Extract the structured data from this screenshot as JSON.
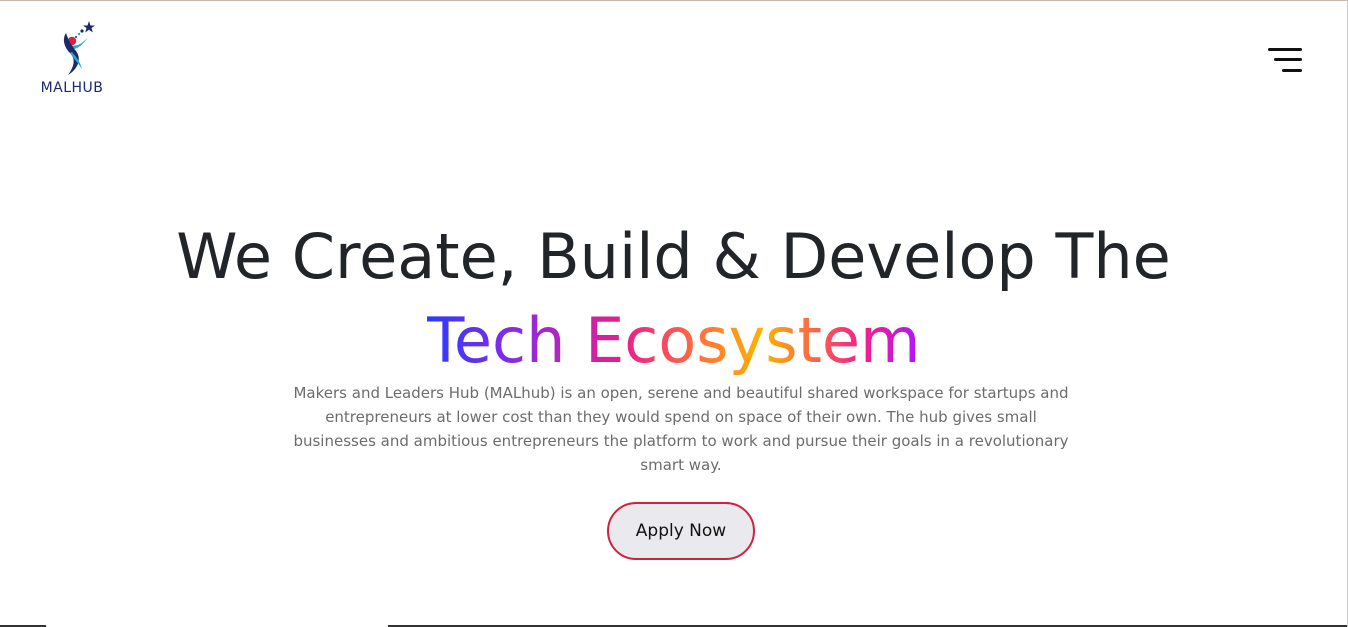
{
  "brand": {
    "name": "MALHUB",
    "icon": "malhub-figure-logo",
    "colors": {
      "figure_blue": "#1c2a6b",
      "figure_red": "#e0203a",
      "figure_cyan": "#2aa7d8",
      "star": "#1c2a6b"
    }
  },
  "header": {
    "menu_icon": "hamburger-menu-icon"
  },
  "hero": {
    "title_line1": "We Create, Build & Develop The",
    "title_highlight": "Tech Ecosystem",
    "description": "Makers and Leaders Hub (MALhub) is an open, serene and beautiful shared workspace for startups and entrepreneurs at lower cost than they would spend on space of their own. The hub gives small businesses and ambitious entrepreneurs the platform to work and pursue their goals in a revolutionary smart way.",
    "cta_label": "Apply Now",
    "cta_border_color": "#d0223f",
    "gradient_colors": [
      "#2b3bff",
      "#8a2be2",
      "#e91e8c",
      "#ff6f3c",
      "#ffb300",
      "#f5208a",
      "#b014ff"
    ]
  }
}
